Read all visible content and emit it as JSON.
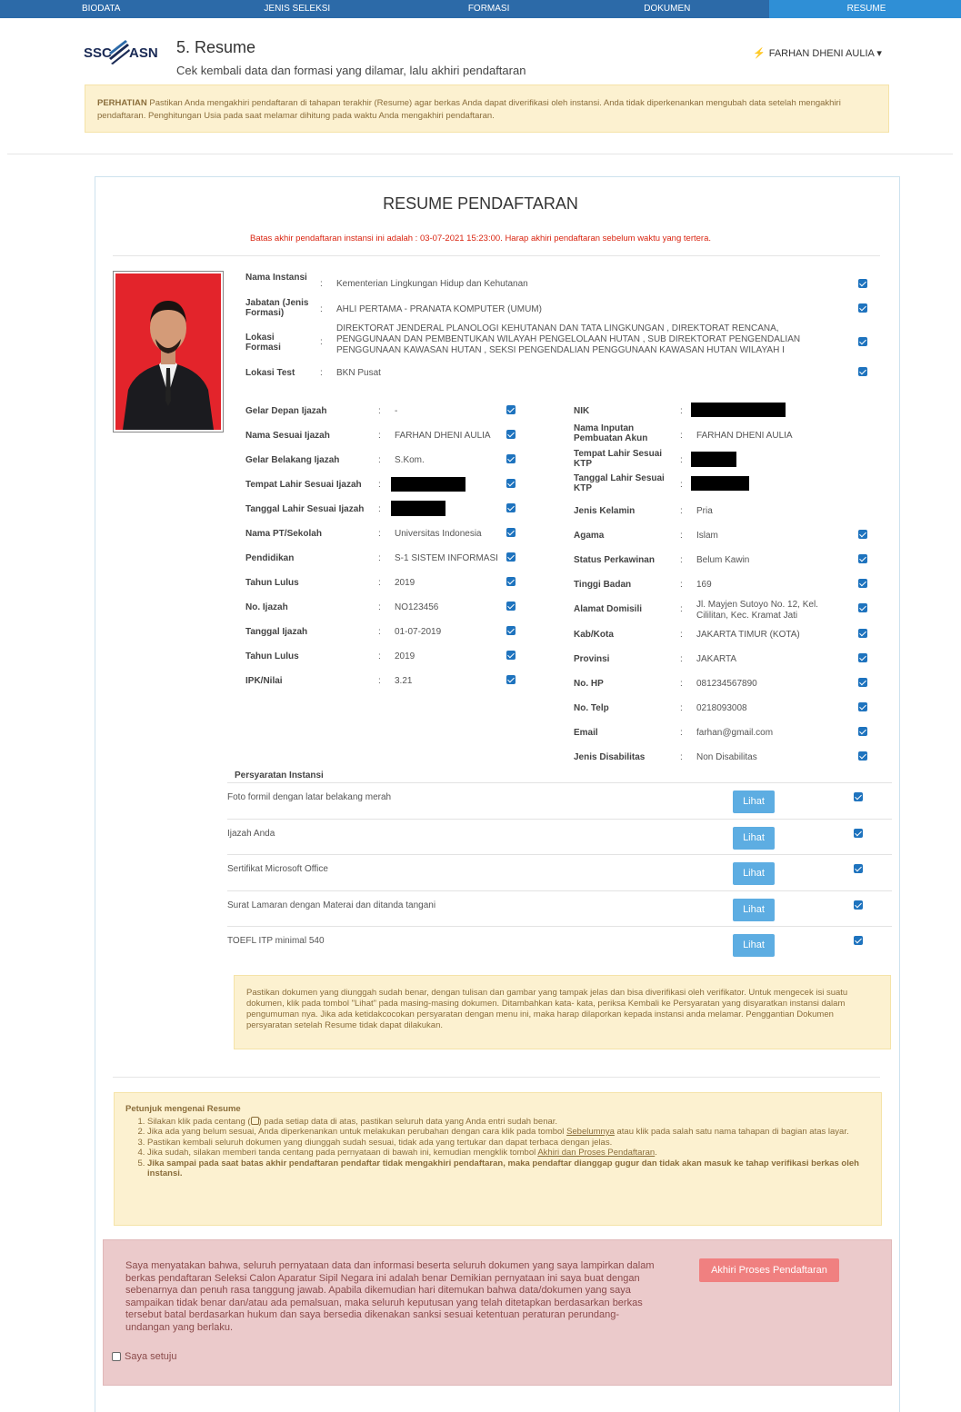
{
  "nav": {
    "tabs": [
      {
        "label": "BIODATA",
        "active": false
      },
      {
        "label": "JENIS SELEKSI",
        "active": false
      },
      {
        "label": "FORMASI",
        "active": false
      },
      {
        "label": "DOKUMEN",
        "active": false
      },
      {
        "label": "RESUME",
        "active": true
      }
    ]
  },
  "header": {
    "logo_left": "SSC",
    "logo_right": "ASN",
    "title": "5. Resume",
    "subtitle": "Cek kembali data dan formasi yang dilamar, lalu akhiri pendaftaran",
    "user_name": "FARHAN DHENI AULIA",
    "user_caret": "▾"
  },
  "alert_top": {
    "label": "PERHATIAN",
    "text": " Pastikan Anda mengakhiri pendaftaran di tahapan terakhir (Resume) agar berkas Anda dapat diverifikasi oleh instansi. Anda tidak diperkenankan mengubah data setelah mengakhiri pendaftaran. Penghitungan Usia pada saat melamar dihitung pada waktu Anda mengakhiri pendaftaran."
  },
  "resume": {
    "title": "RESUME PENDAFTARAN",
    "deadline": "Batas akhir pendaftaran instansi ini adalah : 03-07-2021 15:23:00. Harap akhiri pendaftaran sebelum waktu yang tertera."
  },
  "formasi": {
    "instansi_label": "Nama Instansi",
    "instansi": "Kementerian Lingkungan Hidup dan Kehutanan",
    "jabatan_label": "Jabatan (Jenis Formasi)",
    "jabatan": "AHLI PERTAMA - PRANATA KOMPUTER (UMUM)",
    "lokasi_label": "Lokasi Formasi",
    "lokasi": "DIREKTORAT JENDERAL PLANOLOGI KEHUTANAN DAN TATA LINGKUNGAN , DIREKTORAT RENCANA, PENGGUNAAN DAN PEMBENTUKAN WILAYAH PENGELOLAAN HUTAN , SUB DIREKTORAT PENGENDALIAN PENGGUNAAN KAWASAN HUTAN , SEKSI PENGENDALIAN PENGGUNAAN KAWASAN HUTAN WILAYAH I",
    "test_label": "Lokasi Test",
    "test": "BKN Pusat"
  },
  "left_fields": [
    {
      "label": "Gelar Depan Ijazah",
      "value": "-"
    },
    {
      "label": "Nama Sesuai Ijazah",
      "value": "FARHAN DHENI AULIA"
    },
    {
      "label": "Gelar Belakang Ijazah",
      "value": "S.Kom."
    },
    {
      "label": "Tempat Lahir Sesuai Ijazah",
      "value": ""
    },
    {
      "label": "Tanggal Lahir Sesuai Ijazah",
      "value": ""
    },
    {
      "label": "Nama PT/Sekolah",
      "value": "Universitas Indonesia"
    },
    {
      "label": "Pendidikan",
      "value": "S-1 SISTEM INFORMASI"
    },
    {
      "label": "Tahun Lulus",
      "value": "2019"
    },
    {
      "label": "No. Ijazah",
      "value": "NO123456"
    },
    {
      "label": "Tanggal Ijazah",
      "value": "01-07-2019"
    },
    {
      "label": "Tahun Lulus",
      "value": "2019"
    },
    {
      "label": "IPK/Nilai",
      "value": "3.21"
    }
  ],
  "right_fields": [
    {
      "label": "NIK",
      "value": ""
    },
    {
      "label": "Nama Inputan Pembuatan Akun",
      "value": "FARHAN DHENI AULIA"
    },
    {
      "label": "Tempat Lahir Sesuai KTP",
      "value": ""
    },
    {
      "label": "Tanggal Lahir Sesuai KTP",
      "value": ""
    },
    {
      "label": "Jenis Kelamin",
      "value": "Pria"
    },
    {
      "label": "Agama",
      "value": "Islam"
    },
    {
      "label": "Status Perkawinan",
      "value": "Belum Kawin"
    },
    {
      "label": "Tinggi Badan",
      "value": "169"
    },
    {
      "label": "Alamat Domisili",
      "value": "Jl. Mayjen Sutoyo No. 12, Kel. Cililitan, Kec. Kramat Jati"
    },
    {
      "label": "Kab/Kota",
      "value": "JAKARTA TIMUR (KOTA)"
    },
    {
      "label": "Provinsi",
      "value": "JAKARTA"
    },
    {
      "label": "No. HP",
      "value": "081234567890"
    },
    {
      "label": "No. Telp",
      "value": "0218093008"
    },
    {
      "label": "Email",
      "value": "farhan@gmail.com"
    },
    {
      "label": "Jenis Disabilitas",
      "value": "Non Disabilitas"
    }
  ],
  "persyaratan": {
    "title": "Persyaratan Instansi",
    "button_label": "Lihat",
    "items": [
      "Foto formil dengan latar belakang merah",
      "Ijazah Anda",
      "Sertifikat Microsoft Office",
      "Surat Lamaran dengan Materai dan ditanda tangani",
      "TOEFL ITP minimal 540"
    ]
  },
  "warn_box": {
    "text": "Pastikan dokumen yang diunggah sudah benar, dengan tulisan dan gambar yang tampak jelas dan bisa diverifikasi oleh verifikator. Untuk mengecek isi suatu dokumen, klik pada tombol \"Lihat\" pada masing-masing dokumen. Ditambahkan kata- kata, periksa Kembali ke Persyaratan yang disyaratkan instansi dalam pengumuman nya. Jika ada ketidakcocokan persyaratan dengan menu ini, maka harap dilaporkan kepada instansi anda melamar. Penggantian Dokumen persyaratan setelah Resume tidak dapat dilakukan."
  },
  "petunjuk": {
    "title": "Petunjuk mengenai Resume",
    "item1_a": "Silakan klik pada centang (",
    "item1_b": ") pada setiap data di atas, pastikan seluruh data yang Anda entri sudah benar.",
    "item2_a": "Jika ada yang belum sesuai, Anda diperkenankan untuk melakukan perubahan dengan cara klik pada tombol ",
    "item2_link": "Sebelumnya",
    "item2_b": " atau klik pada salah satu nama tahapan di bagian atas layar.",
    "item3": "Pastikan kembali seluruh dokumen yang diunggah sudah sesuai, tidak ada yang tertukar dan dapat terbaca dengan jelas.",
    "item4_a": "Jika sudah, silakan memberi tanda centang pada pernyataan di bawah ini, kemudian mengklik tombol ",
    "item4_link": "Akhiri dan Proses Pendaftaran",
    "item4_b": ".",
    "item5": "Jika sampai pada saat batas akhir pendaftaran pendaftar tidak mengakhiri pendaftaran, maka pendaftar dianggap gugur dan tidak akan masuk ke tahap verifikasi berkas oleh instansi."
  },
  "declaration": {
    "text": "Saya menyatakan bahwa, seluruh pernyataan data dan informasi beserta seluruh dokumen yang saya lampirkan dalam berkas pendaftaran Seleksi Calon Aparatur Sipil Negara ini adalah benar Demikian pernyataan ini saya buat dengan sebenarnya dan penuh rasa tanggung jawab. Apabila dikemudian hari ditemukan bahwa data/dokumen yang saya sampaikan tidak benar dan/atau ada pemalsuan, maka seluruh keputusan yang telah ditetapkan berdasarkan berkas tersebut batal berdasarkan hukum dan saya bersedia dikenakan sanksi sesuai ketentuan peraturan perundang-undangan yang berlaku.",
    "button_label": "Akhiri Proses Pendaftaran",
    "agree_label": "Saya setuju"
  },
  "colors": {
    "nav": "#2c6aa8",
    "nav_active": "#2f8fd6",
    "checkbox": "#1e73be",
    "lihat": "#5dade2",
    "deadline": "#d9230f",
    "submit": "#f08080"
  }
}
